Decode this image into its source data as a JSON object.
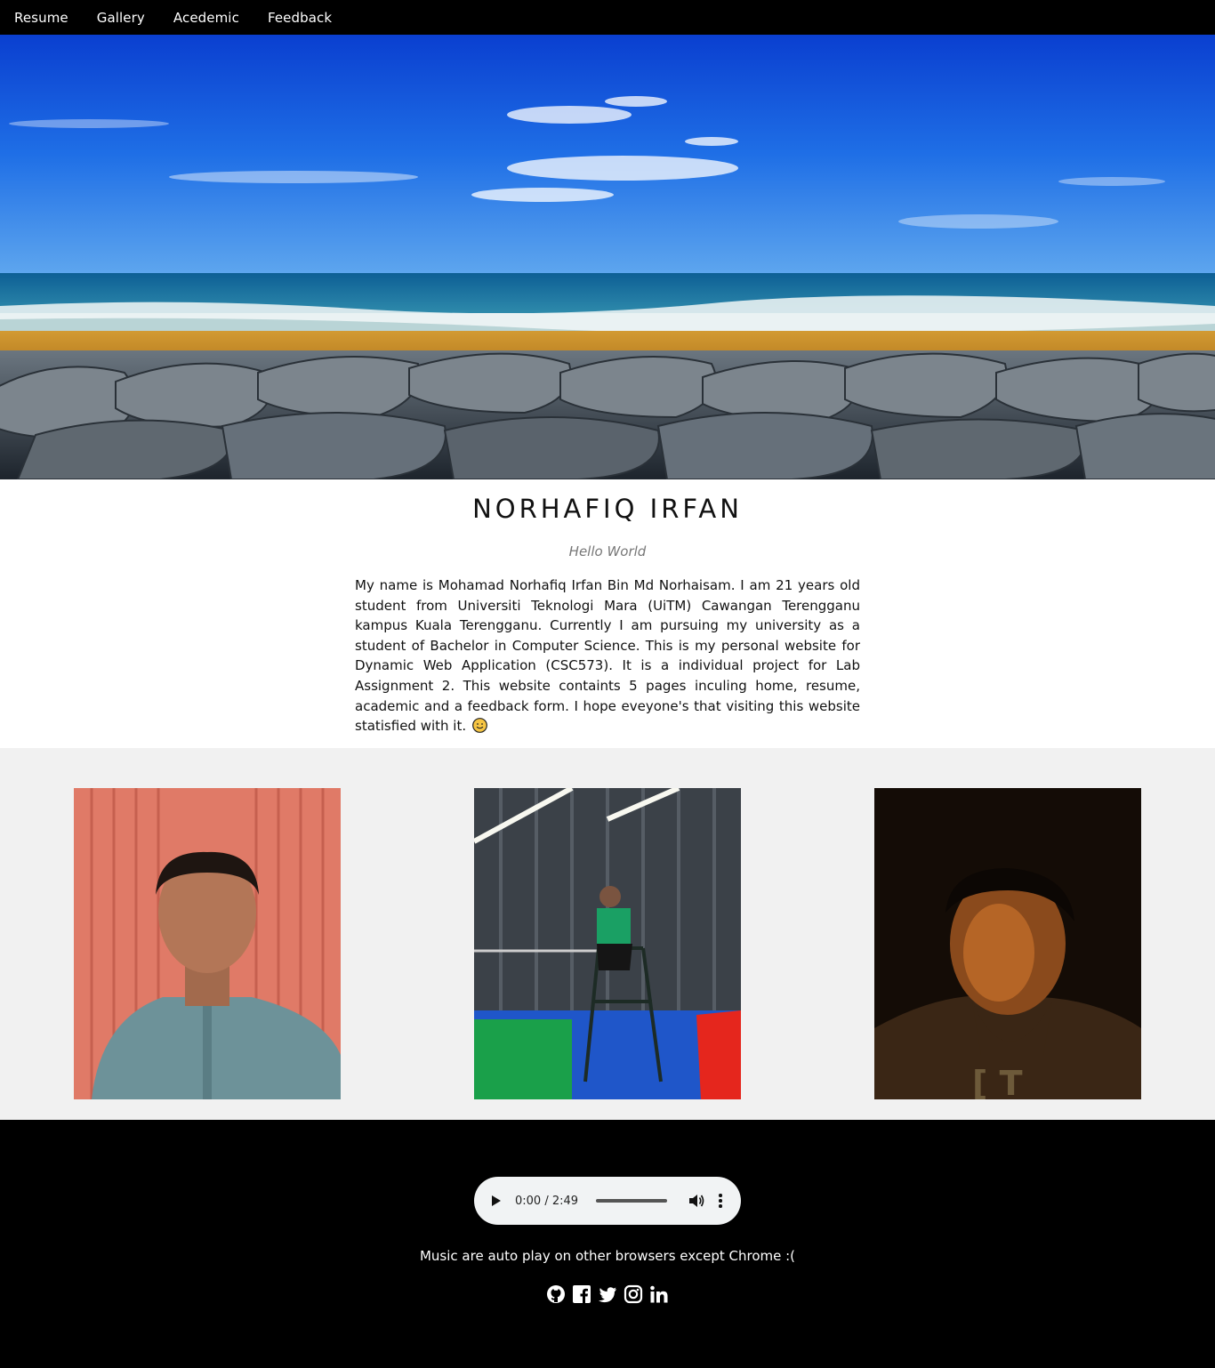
{
  "nav": {
    "items": [
      "Resume",
      "Gallery",
      "Acedemic",
      "Feedback"
    ]
  },
  "intro": {
    "name": "NORHAFIQ IRFAN",
    "tagline": "Hello World",
    "bio": "My name is Mohamad Norhafiq Irfan Bin Md Norhaisam. I am 21 years old student from Universiti Teknologi Mara (UiTM) Cawangan Terengganu kampus Kuala Terengganu. Currently I am pursuing my university as a student of Bachelor in Computer Science. This is my personal website for Dynamic Web Application (CSC573). It is a individual project for Lab Assignment 2. This website containts 5 pages inculing home, resume, academic and a feedback form. I hope eveyone's that visiting this website statisfied with it."
  },
  "audio": {
    "time": "0:00 / 2:49",
    "progress": 0
  },
  "footer": {
    "note": "Music are auto play on other browsers except Chrome :("
  },
  "social": {
    "icons": [
      "github-icon",
      "facebook-icon",
      "twitter-icon",
      "instagram-icon",
      "linkedin-icon"
    ]
  },
  "colors": {
    "nav_bg": "#000000",
    "footer_bg": "#000000",
    "gallery_bg": "#f1f1f1",
    "player_bg": "#f1f3f4"
  }
}
